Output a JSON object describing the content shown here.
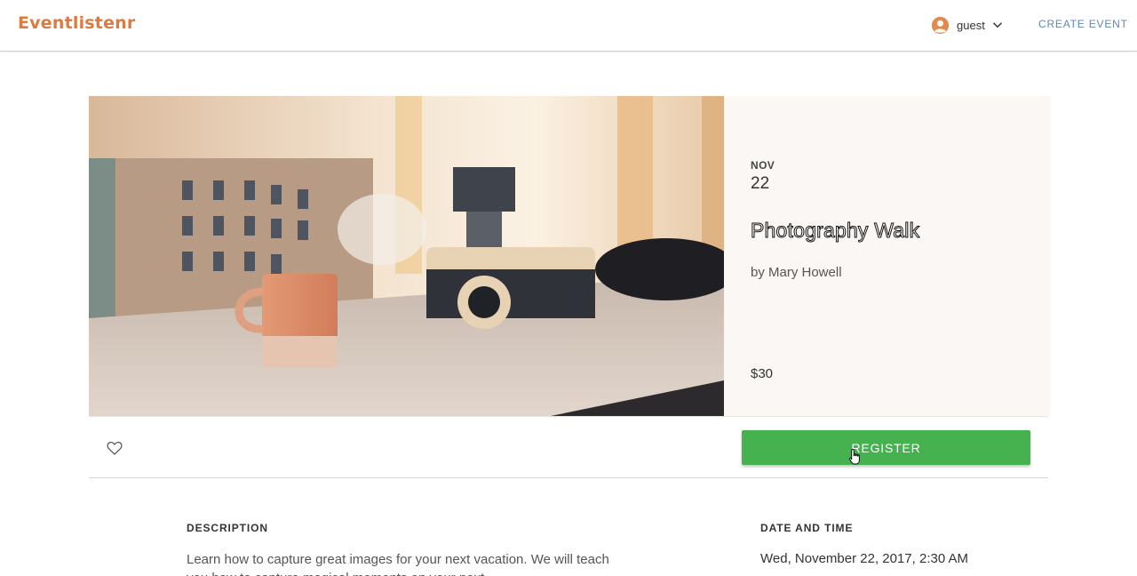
{
  "colors": {
    "brand": "#dd7a3e",
    "accent": "#5f88b6",
    "register": "#46b14f",
    "panel_bg": "#faf7f4"
  },
  "header": {
    "brand": "Eventlistenr",
    "user_name": "guest",
    "user_icon": "user-avatar-icon",
    "dropdown_icon": "chevron-down-icon",
    "create_event": "CREATE EVENT"
  },
  "event": {
    "image_icon": "coffee-cup-and-camera-photo",
    "month": "NOV",
    "day": "22",
    "title": "Photography Walk",
    "host": "by Mary Howell",
    "price": "$30"
  },
  "actions": {
    "like_icon": "heart-icon",
    "register_label": "REGISTER"
  },
  "details": {
    "description_label": "DESCRIPTION",
    "description_text": "Learn how to capture great images for your next vacation. We will teach you how to capture magical moments on your next",
    "datetime_label": "DATE AND TIME",
    "datetime_value": "Wed, November 22, 2017, 2:30 AM"
  }
}
